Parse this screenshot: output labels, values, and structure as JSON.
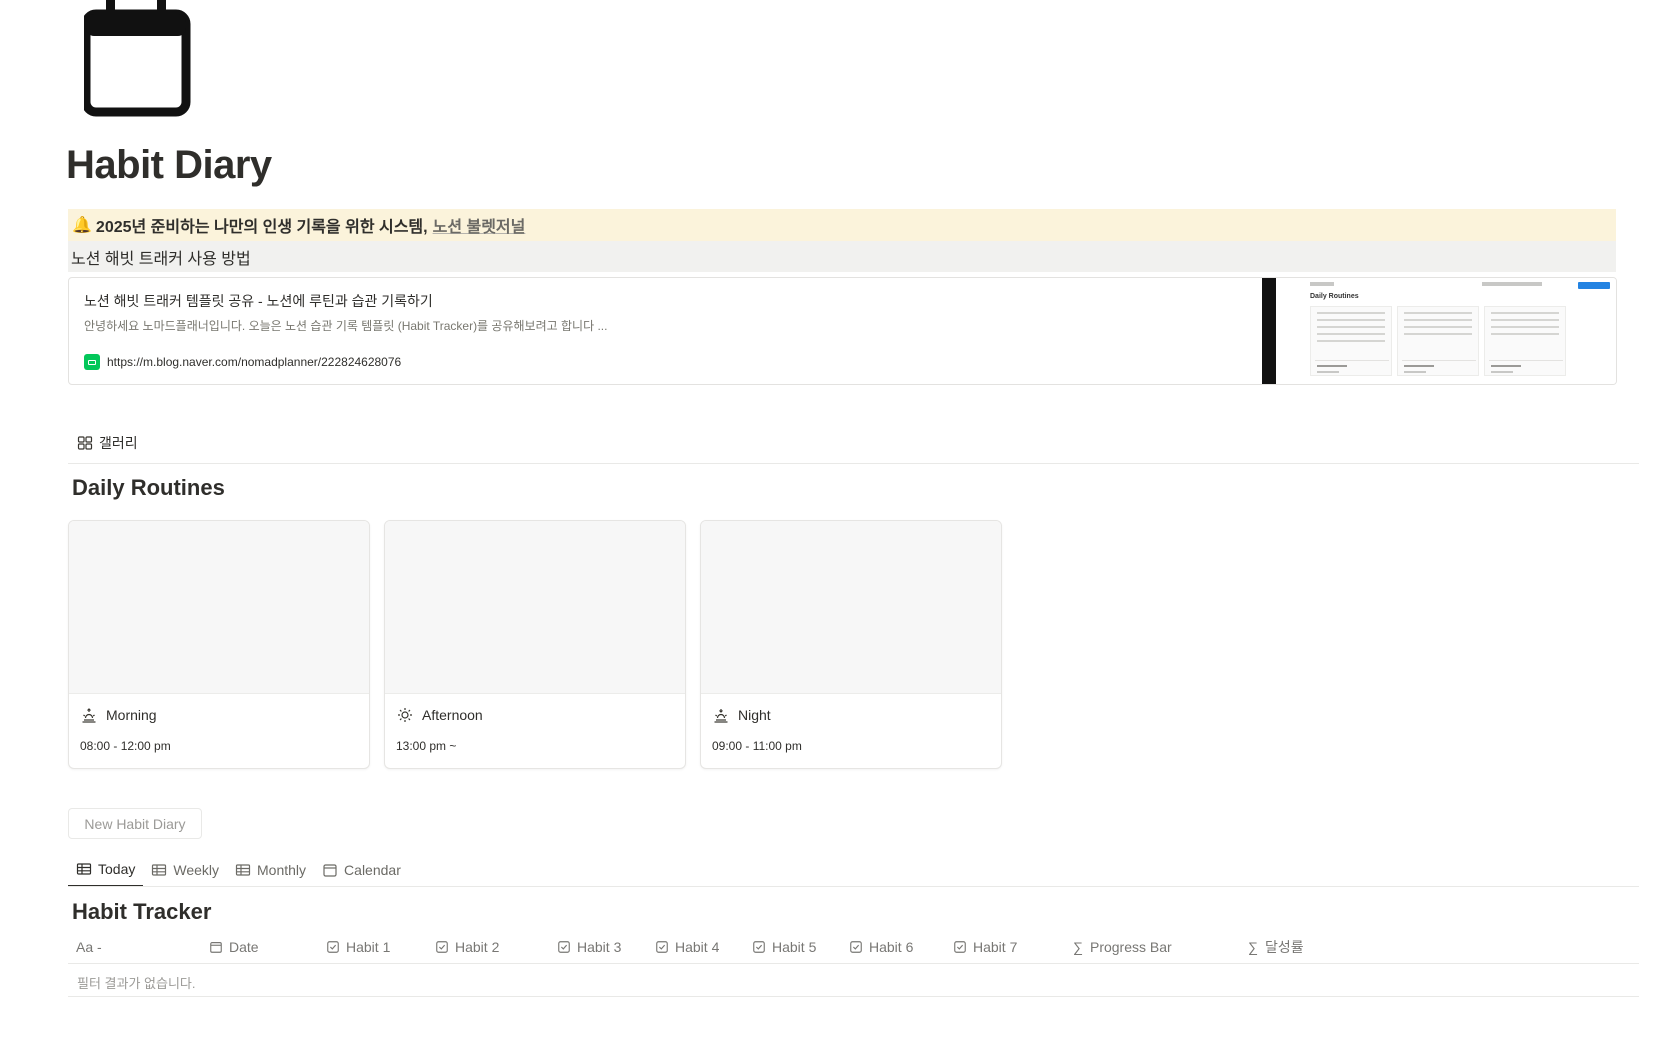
{
  "page": {
    "icon": "calendar-icon",
    "title": "Habit Diary"
  },
  "callout": {
    "icon": "bell-emoji",
    "text": "2025년 준비하는 나만의 인생 기록을 위한 시스템,",
    "link_text": "노션 불렛저널"
  },
  "toggle_heading": {
    "text": "노션 해빗 트래커 사용 방법"
  },
  "bookmark": {
    "title": "노션 해빗 트래커 템플릿 공유 - 노션에 루틴과 습관 기록하기",
    "description": "안녕하세요 노마드플래너입니다. 오늘은 노션 습관 기록 템플릿 (Habit Tracker)를 공유해보려고 합니다 ...",
    "url": "https://m.blog.naver.com/nomadplanner/222824628076",
    "thumbnail_heading": "Daily Routines"
  },
  "gallery_view": {
    "tab_label": "갤러리",
    "title": "Daily Routines",
    "cards": [
      {
        "name": "Morning",
        "icon": "sunrise-icon",
        "time": "08:00 - 12:00 pm"
      },
      {
        "name": "Afternoon",
        "icon": "sun-icon",
        "time": "13:00 pm ~"
      },
      {
        "name": "Night",
        "icon": "sunset-icon",
        "time": "09:00 - 11:00 pm"
      }
    ]
  },
  "habit_db": {
    "new_button": "New Habit Diary",
    "tabs": [
      {
        "label": "Today",
        "icon": "table-icon",
        "active": true
      },
      {
        "label": "Weekly",
        "icon": "table-icon",
        "active": false
      },
      {
        "label": "Monthly",
        "icon": "table-icon",
        "active": false
      },
      {
        "label": "Calendar",
        "icon": "calendar-icon",
        "active": false
      }
    ],
    "title": "Habit Tracker",
    "columns": [
      {
        "label": "Aa -",
        "icon": ""
      },
      {
        "label": "Date",
        "icon": "calendar-icon"
      },
      {
        "label": "Habit 1",
        "icon": "checkbox-icon"
      },
      {
        "label": "Habit 2",
        "icon": "checkbox-icon"
      },
      {
        "label": "Habit 3",
        "icon": "checkbox-icon"
      },
      {
        "label": "Habit 4",
        "icon": "checkbox-icon"
      },
      {
        "label": "Habit 5",
        "icon": "checkbox-icon"
      },
      {
        "label": "Habit 6",
        "icon": "checkbox-icon"
      },
      {
        "label": "Habit 7",
        "icon": "checkbox-icon"
      },
      {
        "label": "Progress Bar",
        "icon": "formula-icon"
      },
      {
        "label": "달성률",
        "icon": "formula-icon"
      }
    ],
    "empty_message": "필터 결과가 없습니다."
  },
  "colors": {
    "callout_bg": "#fbf3db",
    "toggle_bg": "#f1f1ef",
    "text": "#37352f",
    "muted": "#787774",
    "naver_green": "#03c75a"
  }
}
